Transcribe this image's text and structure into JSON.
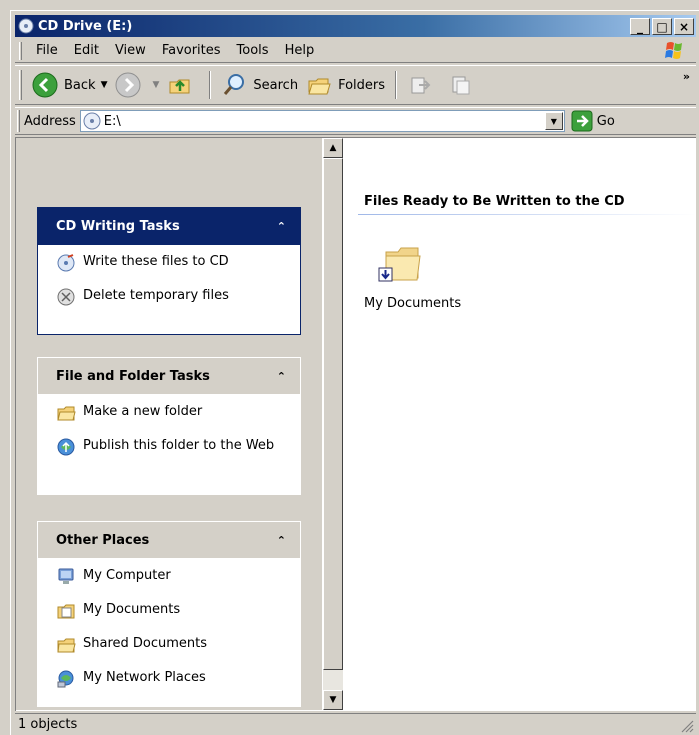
{
  "window": {
    "title": "CD Drive (E:)"
  },
  "title_buttons": {
    "minimize": "_",
    "maximize": "□",
    "close": "×"
  },
  "menu": [
    {
      "label": "File",
      "key": "F"
    },
    {
      "label": "Edit",
      "key": "E"
    },
    {
      "label": "View",
      "key": "V"
    },
    {
      "label": "Favorites",
      "key": "a"
    },
    {
      "label": "Tools",
      "key": "T"
    },
    {
      "label": "Help",
      "key": "H"
    }
  ],
  "toolbar": {
    "back_label": "Back",
    "search_label": "Search",
    "folders_label": "Folders",
    "more": "»"
  },
  "address": {
    "label": "Address",
    "value": "E:\\",
    "go_label": "Go"
  },
  "panels": {
    "cd_writing": {
      "title": "CD Writing Tasks",
      "items": [
        "Write these files to CD",
        "Delete temporary files"
      ]
    },
    "file_folder": {
      "title": "File and Folder Tasks",
      "items": [
        "Make a new folder",
        "Publish this folder to the Web"
      ]
    },
    "other_places": {
      "title": "Other Places",
      "items": [
        "My Computer",
        "My Documents",
        "Shared Documents",
        "My Network Places"
      ]
    }
  },
  "content": {
    "group_title": "Files Ready to Be Written to the CD",
    "files": [
      {
        "name": "My Documents",
        "icon": "folder-pending-icon"
      }
    ]
  },
  "status": {
    "text": "1 objects"
  },
  "colors": {
    "titlebar": "#0a246a",
    "panel_header_active": "#0a246a",
    "face": "#d4d0c8"
  }
}
